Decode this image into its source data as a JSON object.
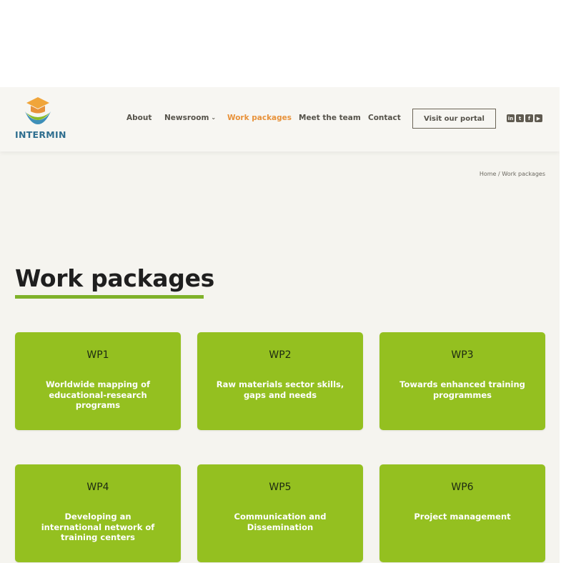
{
  "brand": {
    "name": "INTERMIN"
  },
  "nav": {
    "items": [
      {
        "label": "About",
        "active": false
      },
      {
        "label": "Newsroom",
        "active": false,
        "has_dropdown": true
      },
      {
        "label": "Work packages",
        "active": true
      },
      {
        "label": "Meet the team",
        "active": false
      },
      {
        "label": "Contact",
        "active": false
      }
    ],
    "cta_label": "Visit our portal",
    "socials": [
      "linkedin-icon",
      "twitter-icon",
      "facebook-icon",
      "youtube-icon"
    ]
  },
  "breadcrumb": "Home / Work packages",
  "page_title": "Work packages",
  "colors": {
    "accent": "#e8923a",
    "card_green": "#94c020",
    "title_underline": "#7fb22a",
    "page_bg": "#f5f4ef"
  },
  "cards": [
    {
      "code": "WP1",
      "name": "Worldwide mapping of educational-research programs"
    },
    {
      "code": "WP2",
      "name": "Raw materials sector skills, gaps and needs"
    },
    {
      "code": "WP3",
      "name": "Towards enhanced training programmes"
    },
    {
      "code": "WP4",
      "name": "Developing an international network of training centers"
    },
    {
      "code": "WP5",
      "name": "Communication and Dissemination"
    },
    {
      "code": "WP6",
      "name": "Project management"
    }
  ]
}
